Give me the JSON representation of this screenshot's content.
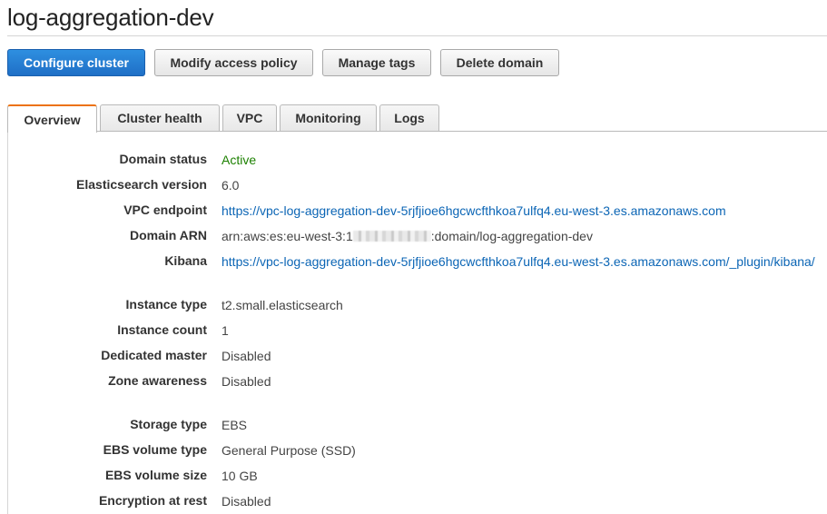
{
  "page": {
    "title": "log-aggregation-dev"
  },
  "actions": {
    "configure": "Configure cluster",
    "modify_policy": "Modify access policy",
    "manage_tags": "Manage tags",
    "delete": "Delete domain"
  },
  "tabs": [
    {
      "label": "Overview",
      "active": true
    },
    {
      "label": "Cluster health",
      "active": false
    },
    {
      "label": "VPC",
      "active": false
    },
    {
      "label": "Monitoring",
      "active": false
    },
    {
      "label": "Logs",
      "active": false
    }
  ],
  "overview": {
    "domain_status": {
      "label": "Domain status",
      "value": "Active"
    },
    "es_version": {
      "label": "Elasticsearch version",
      "value": "6.0"
    },
    "vpc_endpoint": {
      "label": "VPC endpoint",
      "value": "https://vpc-log-aggregation-dev-5rjfjioe6hgcwcfthkoa7ulfq4.eu-west-3.es.amazonaws.com"
    },
    "domain_arn": {
      "label": "Domain ARN",
      "prefix": "arn:aws:es:eu-west-3:1",
      "suffix": ":domain/log-aggregation-dev"
    },
    "kibana": {
      "label": "Kibana",
      "value": "https://vpc-log-aggregation-dev-5rjfjioe6hgcwcfthkoa7ulfq4.eu-west-3.es.amazonaws.com/_plugin/kibana/"
    },
    "instance_type": {
      "label": "Instance type",
      "value": "t2.small.elasticsearch"
    },
    "instance_count": {
      "label": "Instance count",
      "value": "1"
    },
    "dedicated_master": {
      "label": "Dedicated master",
      "value": "Disabled"
    },
    "zone_awareness": {
      "label": "Zone awareness",
      "value": "Disabled"
    },
    "storage_type": {
      "label": "Storage type",
      "value": "EBS"
    },
    "ebs_volume_type": {
      "label": "EBS volume type",
      "value": "General Purpose (SSD)"
    },
    "ebs_volume_size": {
      "label": "EBS volume size",
      "value": "10 GB"
    },
    "encryption": {
      "label": "Encryption at rest",
      "value": "Disabled"
    }
  },
  "colors": {
    "primary": "#1f6fc6",
    "active_tab_accent": "#ec7211",
    "link": "#0b65b5",
    "status_active": "#1d8102"
  }
}
